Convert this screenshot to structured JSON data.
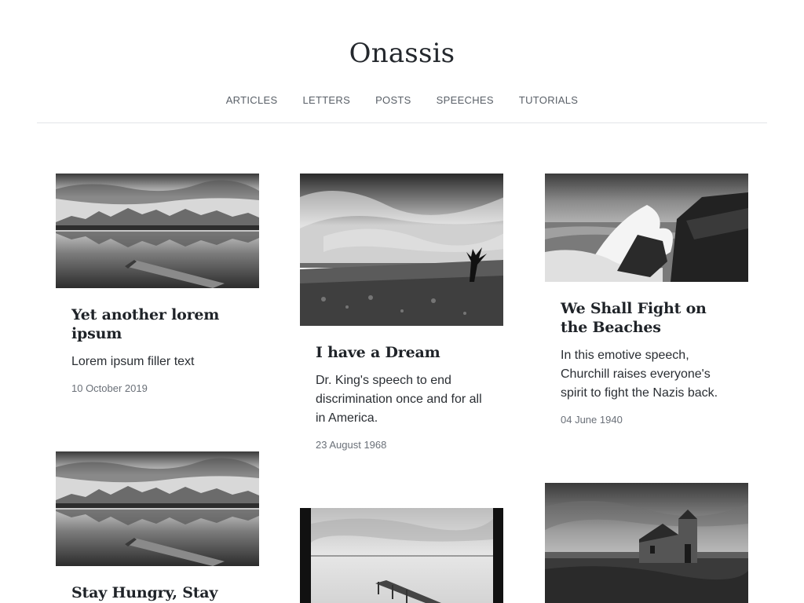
{
  "site": {
    "title": "Onassis"
  },
  "nav": {
    "items": [
      "ARTICLES",
      "LETTERS",
      "POSTS",
      "SPEECHES",
      "TUTORIALS"
    ]
  },
  "cards": [
    {
      "title": "Yet another lorem ipsum",
      "text": "Lorem ipsum filler text",
      "date": "10 October 2019",
      "image": "lake-pier"
    },
    {
      "title": "I have a Dream",
      "text": "Dr. King's speech to end discrimination once and for all in America.",
      "date": "23 August 1968",
      "image": "tree-field"
    },
    {
      "title": "We Shall Fight on the Beaches",
      "text": "In this emotive speech, Churchill raises everyone's spirit to fight the Nazis back.",
      "date": "04 June 1940",
      "image": "crashing-wave"
    },
    {
      "title": "Stay Hungry, Stay",
      "text": "",
      "date": "",
      "image": "lake-pier"
    },
    {
      "title": "",
      "text": "",
      "date": "",
      "image": "misty-pier"
    },
    {
      "title": "",
      "text": "",
      "date": "",
      "image": "stone-church"
    }
  ]
}
